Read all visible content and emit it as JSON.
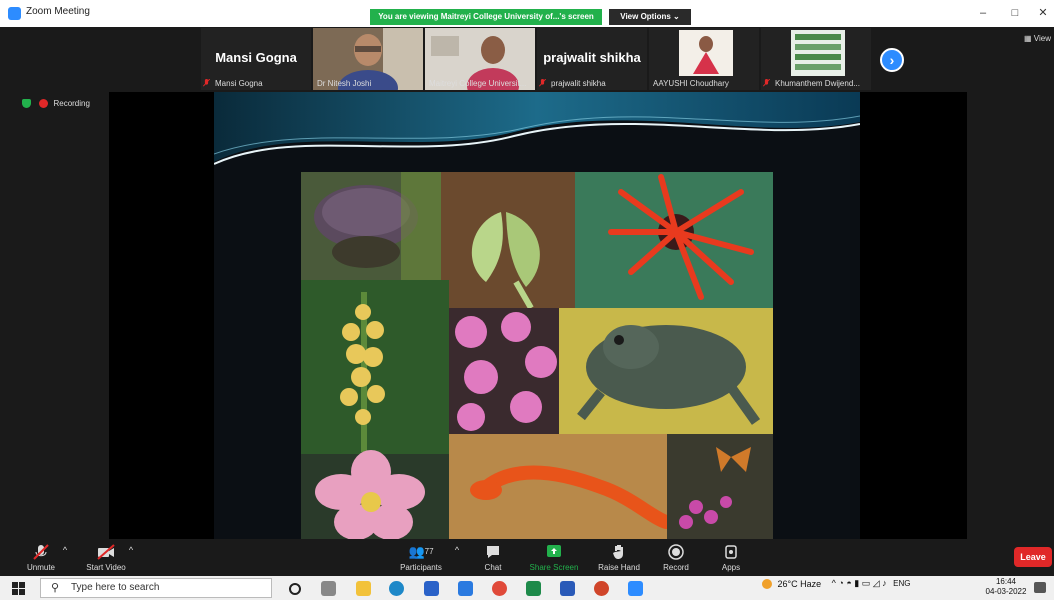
{
  "window": {
    "title": "Zoom Meeting",
    "banner": "You are viewing Maitreyi College University of...'s screen",
    "view_options": "View Options",
    "minimize": "–",
    "maximize": "□",
    "close": "✕"
  },
  "gallery": {
    "tiles": [
      {
        "big": "Mansi Gogna",
        "small": "Mansi Gogna"
      },
      {
        "small": "Dr Nitesh Joshi"
      },
      {
        "small": "Maitreyi College Universit..."
      },
      {
        "big": "prajwalit shikha",
        "small": "prajwalit shikha"
      },
      {
        "small": "AAYUSHI Choudhary"
      },
      {
        "small": "Khumanthem Dwijend..."
      }
    ],
    "view_label": "View"
  },
  "recording": {
    "label": "Recording"
  },
  "toolbar": {
    "unmute": "Unmute",
    "start_video": "Start Video",
    "participants": "Participants",
    "participants_count": "77",
    "chat": "Chat",
    "share_screen": "Share Screen",
    "raise_hand": "Raise Hand",
    "record": "Record",
    "apps": "Apps",
    "leave": "Leave"
  },
  "taskbar": {
    "search_placeholder": "Type here to search",
    "weather": "26°C  Haze",
    "lang": "ENG",
    "time": "16:44",
    "date": "04-03-2022"
  },
  "colors": {
    "zoom_blue": "#2d8cff",
    "banner_green": "#22b14c",
    "leave_red": "#e02828"
  }
}
